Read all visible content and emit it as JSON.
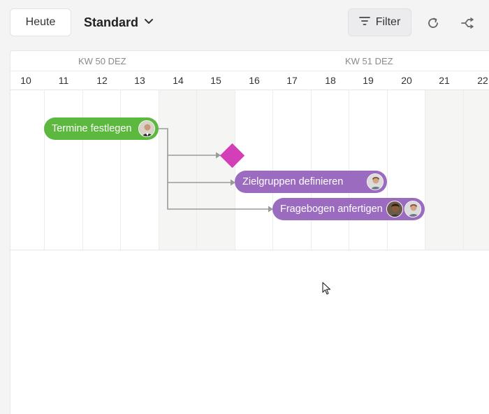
{
  "toolbar": {
    "today_label": "Heute",
    "view_label": "Standard",
    "filter_label": "Filter"
  },
  "timeline": {
    "weeks": [
      {
        "label": "KW 50 DEZ"
      },
      {
        "label": "KW 51 DEZ"
      }
    ],
    "days": [
      "10",
      "11",
      "12",
      "13",
      "14",
      "15",
      "16",
      "17",
      "18",
      "19",
      "20",
      "21",
      "22"
    ]
  },
  "tasks": [
    {
      "label": "Termine festlegen",
      "color": "#5cb83e"
    },
    {
      "label": "Zielgruppen definieren",
      "color": "#9b6bc0"
    },
    {
      "label": "Fragebogen anfertigen",
      "color": "#9b6bc0"
    }
  ],
  "milestone": {
    "color": "#d33fb6"
  },
  "colors": {
    "link": "#9a9a9a"
  }
}
